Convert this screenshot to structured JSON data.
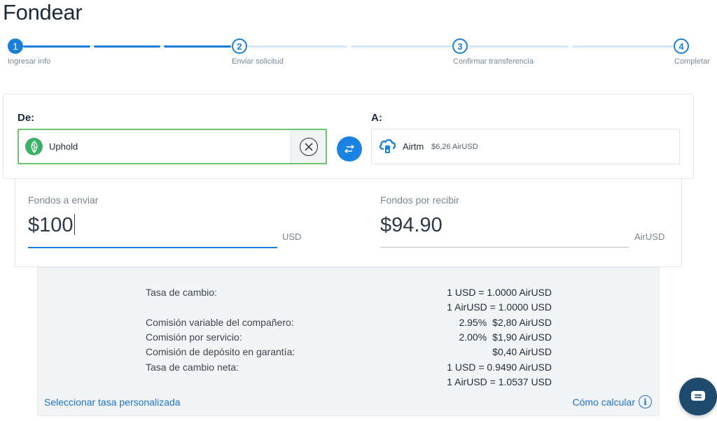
{
  "page": {
    "title": "Fondear"
  },
  "stepper": {
    "steps": [
      {
        "number": "1",
        "label": "Ingresar info",
        "active": true
      },
      {
        "number": "2",
        "label": "Enviar solicitud",
        "active": false
      },
      {
        "number": "3",
        "label": "Confirmar transferencia",
        "active": false
      },
      {
        "number": "4",
        "label": "Completar",
        "active": false
      }
    ]
  },
  "transfer": {
    "from_label": "De:",
    "to_label": "A:",
    "from_account": {
      "name": "Uphold",
      "icon": "uphold-leaf-icon"
    },
    "to_account": {
      "name": "Airtm",
      "balance": "$6,26 AirUSD",
      "icon": "airtm-cloud-icon"
    }
  },
  "amounts": {
    "send": {
      "label": "Fondos a enviar",
      "value": "$100",
      "unit": "USD"
    },
    "receive": {
      "label": "Fondos por recibir",
      "value": "$94.90",
      "unit": "AirUSD"
    }
  },
  "details": {
    "rows": [
      {
        "label": "Tasa de cambio:",
        "value": "1 USD = 1.0000 AirUSD"
      },
      {
        "label": "",
        "value": "1 AirUSD = 1.0000 USD"
      },
      {
        "label": "Comisión variable del compañero:",
        "percent": "2.95%",
        "value": "$2,80 AirUSD"
      },
      {
        "label": "Comisión por servicio:",
        "percent": "2.00%",
        "value": "$1,90 AirUSD"
      },
      {
        "label": "Comisión de depósito en garantía:",
        "value": "$0,40 AirUSD"
      },
      {
        "label": "Tasa de cambio neta:",
        "value": "1 USD = 0.9490 AirUSD"
      },
      {
        "label": "",
        "value": "1 AirUSD = 1.0537 USD"
      }
    ],
    "custom_rate_link": "Seleccionar tasa personalizada",
    "how_calc_link": "Cómo calcular"
  },
  "colors": {
    "primary": "#1a7fd8",
    "success_border": "#6cc46c",
    "chat_bg": "#1e4a6e"
  }
}
